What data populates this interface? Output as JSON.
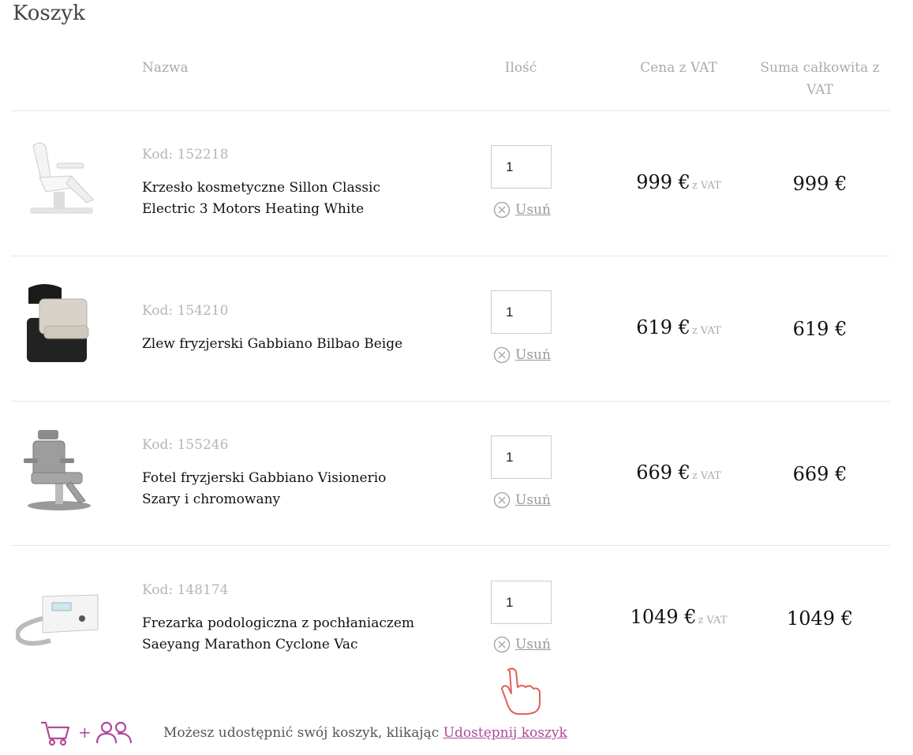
{
  "page": {
    "title": "Koszyk"
  },
  "columns": {
    "name": "Nazwa",
    "qty": "Ilość",
    "price_line1": "Cena z VAT",
    "total_line1": "Suma całkowita z",
    "total_line2": "VAT"
  },
  "remove_label": "Usuń",
  "vat_suffix": "z VAT",
  "items": [
    {
      "code": "Kod: 152218",
      "name_line1": "Krzesło kosmetyczne Sillon Classic",
      "name_line2": "Electric 3 Motors Heating White",
      "qty": "1",
      "price": "999 €",
      "total": "999 €",
      "image": "white-cosmetic-chair"
    },
    {
      "code": "Kod: 154210",
      "name_line1": "Zlew fryzjerski Gabbiano Bilbao Beige",
      "name_line2": "",
      "qty": "1",
      "price": "619 €",
      "total": "619 €",
      "image": "black-beige-wash-unit"
    },
    {
      "code": "Kod: 155246",
      "name_line1": "Fotel fryzjerski Gabbiano Visionerio",
      "name_line2": "Szary i chromowany",
      "qty": "1",
      "price": "669 €",
      "total": "669 €",
      "image": "grey-barber-chair"
    },
    {
      "code": "Kod: 148174",
      "name_line1": "Frezarka podologiczna z pochłaniaczem",
      "name_line2": "Saeyang Marathon Cyclone Vac",
      "qty": "1",
      "price": "1049 €",
      "total": "1049 €",
      "image": "podology-drill-unit"
    }
  ],
  "share": {
    "text": "Możesz udostępnić swój koszyk, klikając",
    "link": "Udostępnij koszyk",
    "plus": "+",
    "icons": [
      "cart-icon",
      "users-icon",
      "pointing-hand-icon"
    ]
  },
  "colors": {
    "accent": "#b04a9a",
    "hand": "#e0605a",
    "muted": "#aaaaaa"
  }
}
